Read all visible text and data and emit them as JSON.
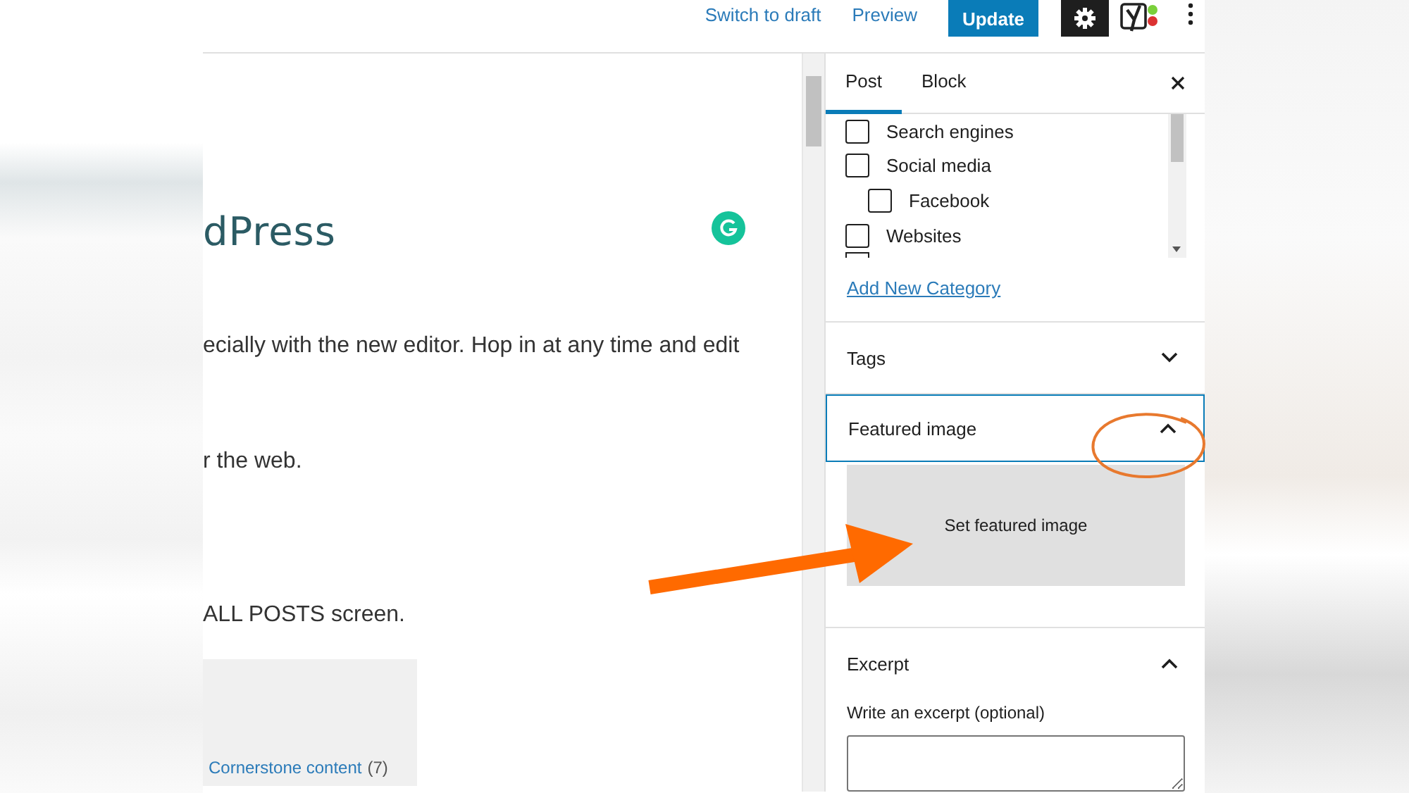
{
  "toolbar": {
    "actions": [
      {
        "label": "Switch to draft",
        "kind": "link"
      },
      {
        "label": "Preview",
        "kind": "link"
      },
      {
        "label": "Update",
        "kind": "primary"
      }
    ],
    "settings": {
      "pressed": true
    }
  },
  "editor": {
    "title": "dPress",
    "paragraphs": [
      "ecially with the new editor. Hop in at any time and edit",
      "r the web.",
      "ALL POSTS screen."
    ],
    "card": {
      "link": "Cornerstone content",
      "count": "(7)"
    }
  },
  "sidebar": {
    "tabs": [
      {
        "label": "Post",
        "selected": true
      },
      {
        "label": "Block",
        "selected": false
      }
    ],
    "categories": [
      {
        "label": "Search engines",
        "checked": false
      },
      {
        "label": "Social media",
        "checked": false,
        "children": [
          {
            "label": "Facebook",
            "checked": false
          }
        ]
      },
      {
        "label": "Websites",
        "checked": false
      }
    ],
    "add_category": "Add New Category",
    "panels": [
      {
        "title": "Tags",
        "expanded": false,
        "focused": false
      },
      {
        "title": "Featured image",
        "expanded": true,
        "focused": true,
        "kind": "image",
        "button": "Set featured image"
      },
      {
        "title": "Excerpt",
        "expanded": true,
        "focused": false,
        "kind": "excerpt",
        "field_label": "Write an excerpt (optional)"
      }
    ]
  }
}
